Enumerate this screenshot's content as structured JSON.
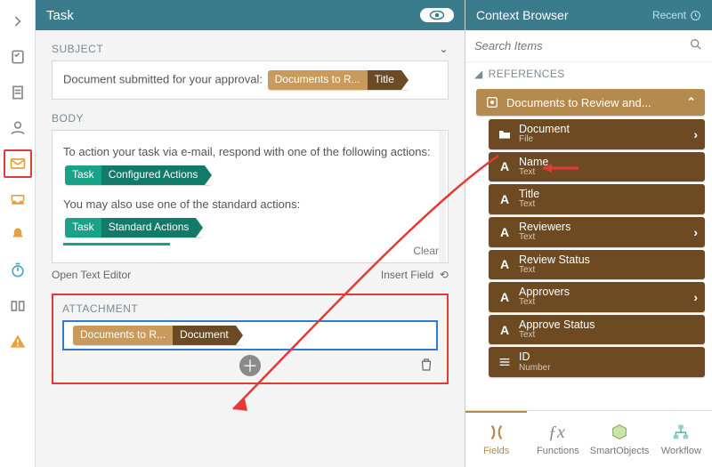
{
  "task": {
    "title": "Task",
    "sections": {
      "subject": {
        "heading": "SUBJECT",
        "prefix_text": "Document submitted for your approval:",
        "tag": {
          "a": "Documents to R...",
          "b": "Title"
        }
      },
      "body": {
        "heading": "BODY",
        "line1": "To action your task via e-mail, respond with one of the following actions:",
        "tag1": {
          "a": "Task",
          "b": "Configured Actions"
        },
        "line2": "You may also use one of the standard actions:",
        "tag2": {
          "a": "Task",
          "b": "Standard Actions"
        },
        "clear": "Clear",
        "open_editor": "Open Text Editor",
        "insert_field": "Insert Field"
      },
      "attachment": {
        "heading": "ATTACHMENT",
        "tag": {
          "a": "Documents to R...",
          "b": "Document"
        }
      }
    }
  },
  "context": {
    "title": "Context Browser",
    "recent": "Recent",
    "search_placeholder": "Search Items",
    "references_heading": "REFERENCES",
    "group": "Documents to Review and...",
    "fields": [
      {
        "label": "Document",
        "type": "File",
        "icon": "folder",
        "chev": true
      },
      {
        "label": "Name",
        "type": "Text",
        "icon": "A",
        "chev": false
      },
      {
        "label": "Title",
        "type": "Text",
        "icon": "A",
        "chev": false
      },
      {
        "label": "Reviewers",
        "type": "Text",
        "icon": "A",
        "chev": true
      },
      {
        "label": "Review Status",
        "type": "Text",
        "icon": "A",
        "chev": false
      },
      {
        "label": "Approvers",
        "type": "Text",
        "icon": "A",
        "chev": true
      },
      {
        "label": "Approve Status",
        "type": "Text",
        "icon": "A",
        "chev": false
      },
      {
        "label": "ID",
        "type": "Number",
        "icon": "list",
        "chev": false
      }
    ],
    "tabs": {
      "fields": "Fields",
      "functions": "Functions",
      "smartobjects": "SmartObjects",
      "workflow": "Workflow"
    }
  }
}
